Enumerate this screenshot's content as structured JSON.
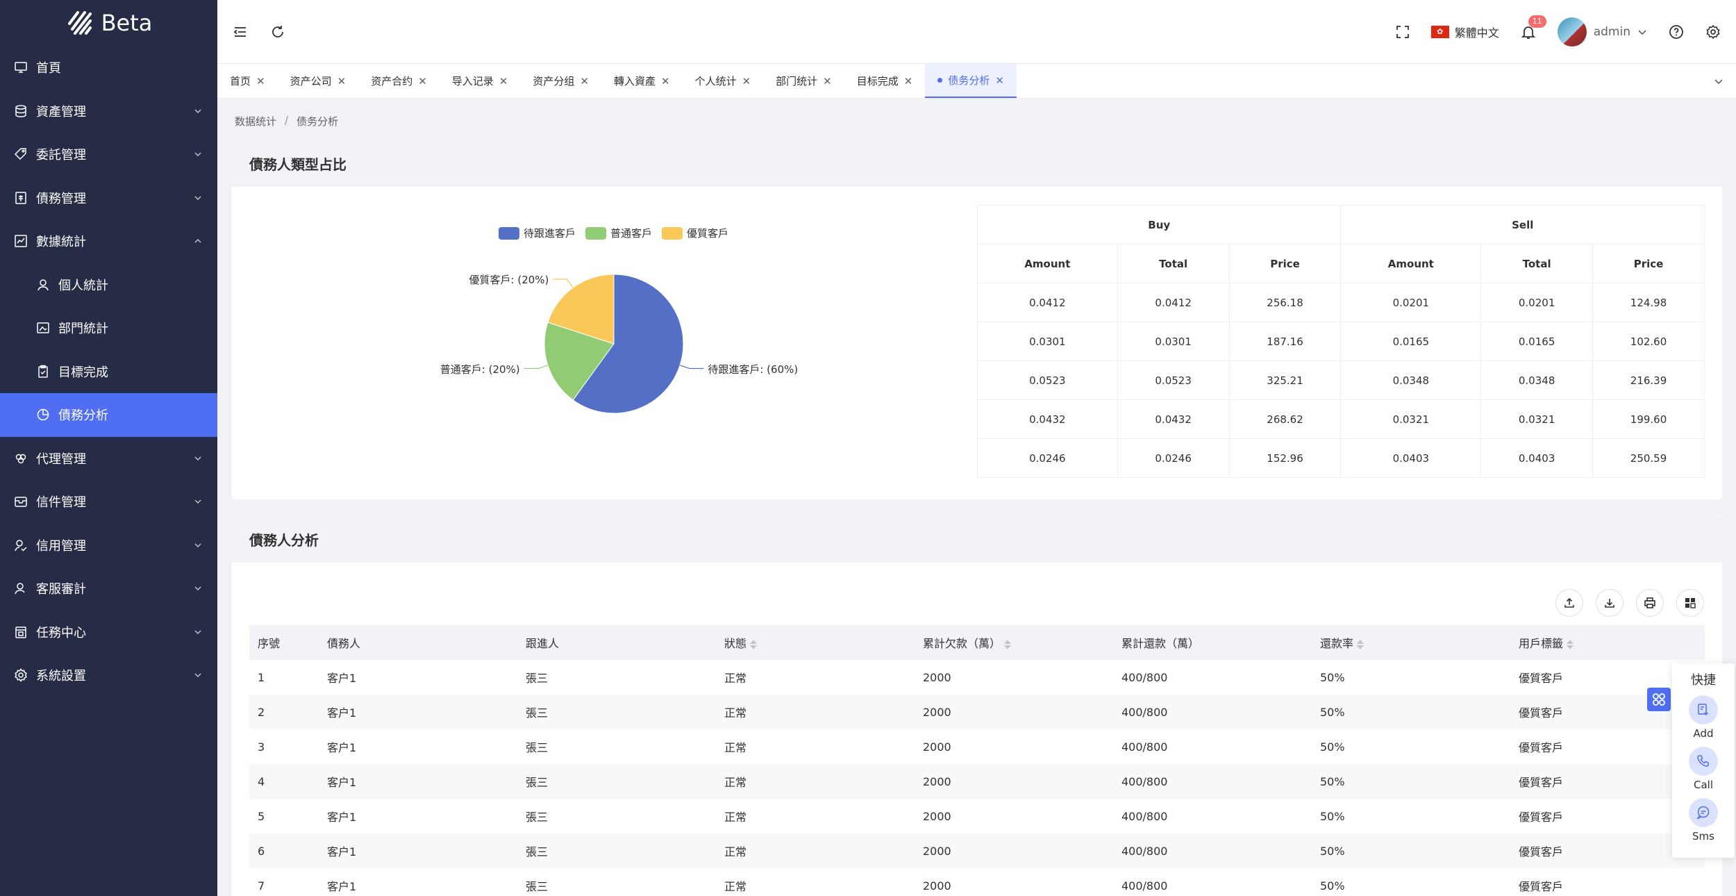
{
  "app": {
    "logo_text": "Beta"
  },
  "sidebar": {
    "items": [
      {
        "label": "首頁",
        "icon": "monitor-icon",
        "arrow": false
      },
      {
        "label": "資產管理",
        "icon": "database-icon",
        "arrow": true
      },
      {
        "label": "委託管理",
        "icon": "tag-icon",
        "arrow": true
      },
      {
        "label": "債務管理",
        "icon": "ledger-icon",
        "arrow": true
      },
      {
        "label": "數據統計",
        "icon": "chart-icon",
        "arrow": true,
        "expanded": true
      },
      {
        "label": "個人統計",
        "icon": "user-icon",
        "sub": true
      },
      {
        "label": "部門統計",
        "icon": "image-icon",
        "sub": true
      },
      {
        "label": "目標完成",
        "icon": "clipboard-icon",
        "sub": true
      },
      {
        "label": "債務分析",
        "icon": "pie-icon",
        "sub": true,
        "active": true
      },
      {
        "label": "代理管理",
        "icon": "people-icon",
        "arrow": true
      },
      {
        "label": "信件管理",
        "icon": "mailbox-icon",
        "arrow": true
      },
      {
        "label": "信用管理",
        "icon": "user-check-icon",
        "arrow": true
      },
      {
        "label": "客服審計",
        "icon": "person-icon",
        "arrow": true
      },
      {
        "label": "任務中心",
        "icon": "calendar-icon",
        "arrow": true
      },
      {
        "label": "系統設置",
        "icon": "gear-icon",
        "arrow": true
      }
    ]
  },
  "header": {
    "language": "繁體中文",
    "notification_count": "11",
    "username": "admin"
  },
  "tabs": [
    {
      "label": "首页"
    },
    {
      "label": "资产公司"
    },
    {
      "label": "资产合约"
    },
    {
      "label": "导入记录"
    },
    {
      "label": "资产分组"
    },
    {
      "label": "轉入資產"
    },
    {
      "label": "个人统计"
    },
    {
      "label": "部门统计"
    },
    {
      "label": "目标完成"
    },
    {
      "label": "债务分析",
      "active": true
    }
  ],
  "breadcrumb": {
    "parent": "数据统计",
    "sep": "/",
    "current": "债务分析"
  },
  "section1": {
    "title": "債務人類型占比",
    "order_table": {
      "group_headers": [
        "Buy",
        "Sell"
      ],
      "sub_headers": [
        "Amount",
        "Total",
        "Price",
        "Amount",
        "Total",
        "Price"
      ],
      "rows": [
        [
          "0.0412",
          "0.0412",
          "256.18",
          "0.0201",
          "0.0201",
          "124.98"
        ],
        [
          "0.0301",
          "0.0301",
          "187.16",
          "0.0165",
          "0.0165",
          "102.60"
        ],
        [
          "0.0523",
          "0.0523",
          "325.21",
          "0.0348",
          "0.0348",
          "216.39"
        ],
        [
          "0.0432",
          "0.0432",
          "268.62",
          "0.0321",
          "0.0321",
          "199.60"
        ],
        [
          "0.0246",
          "0.0246",
          "152.96",
          "0.0403",
          "0.0403",
          "250.59"
        ]
      ]
    }
  },
  "chart_data": {
    "type": "pie",
    "categories": [
      "待跟進客戶",
      "普通客戶",
      "優質客戶"
    ],
    "values": [
      60,
      20,
      20
    ],
    "colors": [
      "#5470c6",
      "#91cc75",
      "#fac858"
    ],
    "slice_labels": [
      "待跟進客戶: (60%)",
      "普通客戶: (20%)",
      "優質客戶: (20%)"
    ],
    "legend": "top"
  },
  "section2": {
    "title": "債務人分析",
    "tools": [
      "upload-icon",
      "download-icon",
      "print-icon",
      "columns-icon"
    ],
    "columns": [
      "序號",
      "債務人",
      "跟進人",
      "狀態",
      "累計欠款（萬）",
      "累計還款（萬）",
      "還款率",
      "用戶標籤"
    ],
    "sortable": [
      false,
      false,
      false,
      true,
      true,
      false,
      true,
      true
    ],
    "rows": [
      [
        "1",
        "客户1",
        "張三",
        "正常",
        "2000",
        "400/800",
        "50%",
        "優質客戶"
      ],
      [
        "2",
        "客户1",
        "張三",
        "正常",
        "2000",
        "400/800",
        "50%",
        "優質客戶"
      ],
      [
        "3",
        "客户1",
        "張三",
        "正常",
        "2000",
        "400/800",
        "50%",
        "優質客戶"
      ],
      [
        "4",
        "客户1",
        "張三",
        "正常",
        "2000",
        "400/800",
        "50%",
        "優質客戶"
      ],
      [
        "5",
        "客户1",
        "張三",
        "正常",
        "2000",
        "400/800",
        "50%",
        "優質客戶"
      ],
      [
        "6",
        "客户1",
        "張三",
        "正常",
        "2000",
        "400/800",
        "50%",
        "優質客戶"
      ],
      [
        "7",
        "客户1",
        "張三",
        "正常",
        "2000",
        "400/800",
        "50%",
        "優質客戶"
      ]
    ]
  },
  "quick_panel": {
    "title": "快捷",
    "items": [
      {
        "label": "Add",
        "icon": "add-note-icon"
      },
      {
        "label": "Call",
        "icon": "phone-icon"
      },
      {
        "label": "Sms",
        "icon": "chat-icon"
      }
    ]
  }
}
